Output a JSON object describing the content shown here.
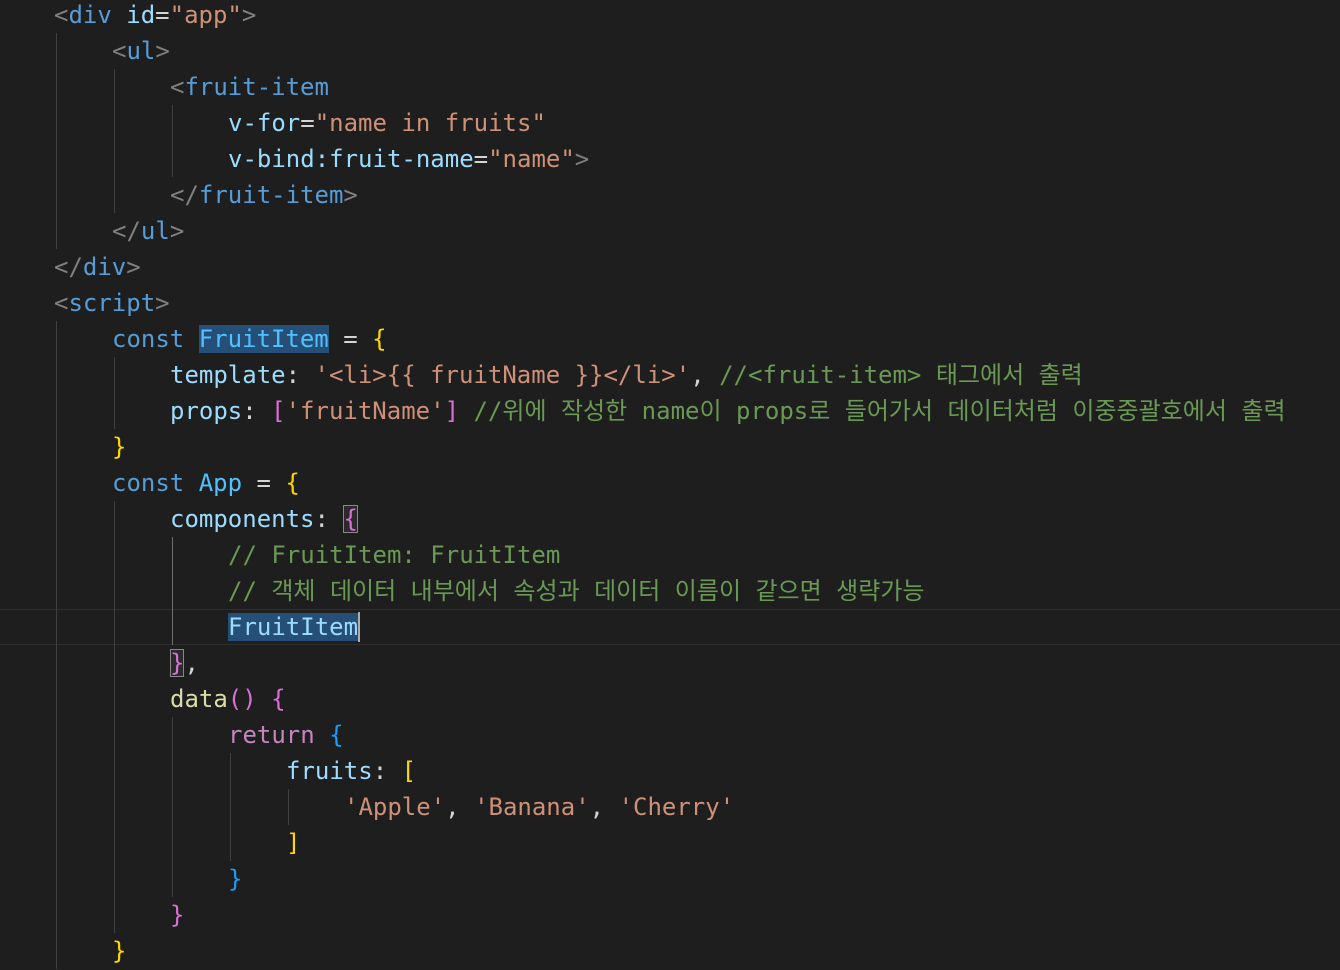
{
  "editor": {
    "language": "vue-html",
    "cursor_line": 18,
    "colors": {
      "background": "#1e1e1e",
      "tag": "#569cd6",
      "attribute": "#9cdcfe",
      "string": "#ce9178",
      "keyword": "#569cd6",
      "control": "#c586c0",
      "function": "#dcdcaa",
      "comment": "#6a9955",
      "bracket_1": "#ffd700",
      "bracket_2": "#da70d6",
      "bracket_3": "#179fff",
      "selection": "#264f78"
    },
    "lines": [
      {
        "indent": 1,
        "tokens": [
          {
            "t": "<",
            "c": "t-punct"
          },
          {
            "t": "div",
            "c": "t-tag"
          },
          {
            "t": " ",
            "c": ""
          },
          {
            "t": "id",
            "c": "t-attr"
          },
          {
            "t": "=",
            "c": "t-op"
          },
          {
            "t": "\"app\"",
            "c": "t-str"
          },
          {
            "t": ">",
            "c": "t-punct"
          }
        ]
      },
      {
        "indent": 2,
        "tokens": [
          {
            "t": "<",
            "c": "t-punct"
          },
          {
            "t": "ul",
            "c": "t-tag"
          },
          {
            "t": ">",
            "c": "t-punct"
          }
        ]
      },
      {
        "indent": 3,
        "tokens": [
          {
            "t": "<",
            "c": "t-punct"
          },
          {
            "t": "fruit-item",
            "c": "t-tag"
          }
        ]
      },
      {
        "indent": 4,
        "tokens": [
          {
            "t": "v-for",
            "c": "t-attr"
          },
          {
            "t": "=",
            "c": "t-op"
          },
          {
            "t": "\"name in fruits\"",
            "c": "t-str"
          }
        ]
      },
      {
        "indent": 4,
        "tokens": [
          {
            "t": "v-bind:fruit-name",
            "c": "t-attr"
          },
          {
            "t": "=",
            "c": "t-op"
          },
          {
            "t": "\"name\"",
            "c": "t-str"
          },
          {
            "t": ">",
            "c": "t-punct"
          }
        ]
      },
      {
        "indent": 3,
        "tokens": [
          {
            "t": "</",
            "c": "t-punct"
          },
          {
            "t": "fruit-item",
            "c": "t-tag"
          },
          {
            "t": ">",
            "c": "t-punct"
          }
        ]
      },
      {
        "indent": 2,
        "tokens": [
          {
            "t": "</",
            "c": "t-punct"
          },
          {
            "t": "ul",
            "c": "t-tag"
          },
          {
            "t": ">",
            "c": "t-punct"
          }
        ]
      },
      {
        "indent": 1,
        "tokens": [
          {
            "t": "</",
            "c": "t-punct"
          },
          {
            "t": "div",
            "c": "t-tag"
          },
          {
            "t": ">",
            "c": "t-punct"
          }
        ]
      },
      {
        "indent": 1,
        "tokens": [
          {
            "t": "<",
            "c": "t-punct"
          },
          {
            "t": "script",
            "c": "t-tag"
          },
          {
            "t": ">",
            "c": "t-punct"
          }
        ]
      },
      {
        "indent": 2,
        "tokens": [
          {
            "t": "const",
            "c": "t-key"
          },
          {
            "t": " ",
            "c": ""
          },
          {
            "t": "FruitItem",
            "c": "t-cls hl-word"
          },
          {
            "t": " = ",
            "c": "t-op"
          },
          {
            "t": "{",
            "c": "t-b1"
          }
        ]
      },
      {
        "indent": 3,
        "tokens": [
          {
            "t": "template",
            "c": "t-var"
          },
          {
            "t": ": ",
            "c": "t-op"
          },
          {
            "t": "'<li>{{ fruitName }}</li>'",
            "c": "t-str"
          },
          {
            "t": ", ",
            "c": "t-op"
          },
          {
            "t": "//<fruit-item> 태그에서 출력",
            "c": "t-com"
          }
        ]
      },
      {
        "indent": 3,
        "tokens": [
          {
            "t": "props",
            "c": "t-var"
          },
          {
            "t": ": ",
            "c": "t-op"
          },
          {
            "t": "[",
            "c": "t-b2"
          },
          {
            "t": "'fruitName'",
            "c": "t-str"
          },
          {
            "t": "]",
            "c": "t-b2"
          },
          {
            "t": " ",
            "c": ""
          },
          {
            "t": "//위에 작성한 name이 props로 들어가서 데이터처럼 이중중괄호에서 출력",
            "c": "t-com"
          }
        ]
      },
      {
        "indent": 2,
        "tokens": [
          {
            "t": "}",
            "c": "t-b1"
          }
        ]
      },
      {
        "indent": 2,
        "tokens": [
          {
            "t": "const",
            "c": "t-key"
          },
          {
            "t": " ",
            "c": ""
          },
          {
            "t": "App",
            "c": "t-cls"
          },
          {
            "t": " = ",
            "c": "t-op"
          },
          {
            "t": "{",
            "c": "t-b1"
          }
        ]
      },
      {
        "indent": 3,
        "tokens": [
          {
            "t": "components",
            "c": "t-var"
          },
          {
            "t": ": ",
            "c": "t-op"
          },
          {
            "t": "{",
            "c": "t-b2 hl-bracket"
          }
        ]
      },
      {
        "indent": 4,
        "tokens": [
          {
            "t": "// FruitItem: FruitItem",
            "c": "t-com"
          }
        ]
      },
      {
        "indent": 4,
        "tokens": [
          {
            "t": "// 객체 데이터 내부에서 속성과 데이터 이름이 같으면 생략가능",
            "c": "t-com"
          }
        ]
      },
      {
        "indent": 4,
        "tokens": [
          {
            "t": "FruitItem",
            "c": "t-var hl-word"
          }
        ]
      },
      {
        "indent": 3,
        "tokens": [
          {
            "t": "}",
            "c": "t-b2 hl-bracket"
          },
          {
            "t": ",",
            "c": "t-op"
          }
        ]
      },
      {
        "indent": 3,
        "tokens": [
          {
            "t": "data",
            "c": "t-fn"
          },
          {
            "t": "()",
            "c": "t-b2"
          },
          {
            "t": " ",
            "c": ""
          },
          {
            "t": "{",
            "c": "t-b2"
          }
        ]
      },
      {
        "indent": 4,
        "tokens": [
          {
            "t": "return",
            "c": "t-ctl"
          },
          {
            "t": " ",
            "c": ""
          },
          {
            "t": "{",
            "c": "t-b3"
          }
        ]
      },
      {
        "indent": 5,
        "tokens": [
          {
            "t": "fruits",
            "c": "t-var"
          },
          {
            "t": ": ",
            "c": "t-op"
          },
          {
            "t": "[",
            "c": "t-b1"
          }
        ]
      },
      {
        "indent": 6,
        "tokens": [
          {
            "t": "'Apple'",
            "c": "t-str"
          },
          {
            "t": ", ",
            "c": "t-op"
          },
          {
            "t": "'Banana'",
            "c": "t-str"
          },
          {
            "t": ", ",
            "c": "t-op"
          },
          {
            "t": "'Cherry'",
            "c": "t-str"
          }
        ]
      },
      {
        "indent": 5,
        "tokens": [
          {
            "t": "]",
            "c": "t-b1"
          }
        ]
      },
      {
        "indent": 4,
        "tokens": [
          {
            "t": "}",
            "c": "t-b3"
          }
        ]
      },
      {
        "indent": 3,
        "tokens": [
          {
            "t": "}",
            "c": "t-b2"
          }
        ]
      },
      {
        "indent": 2,
        "tokens": [
          {
            "t": "}",
            "c": "t-b1"
          }
        ]
      }
    ]
  }
}
